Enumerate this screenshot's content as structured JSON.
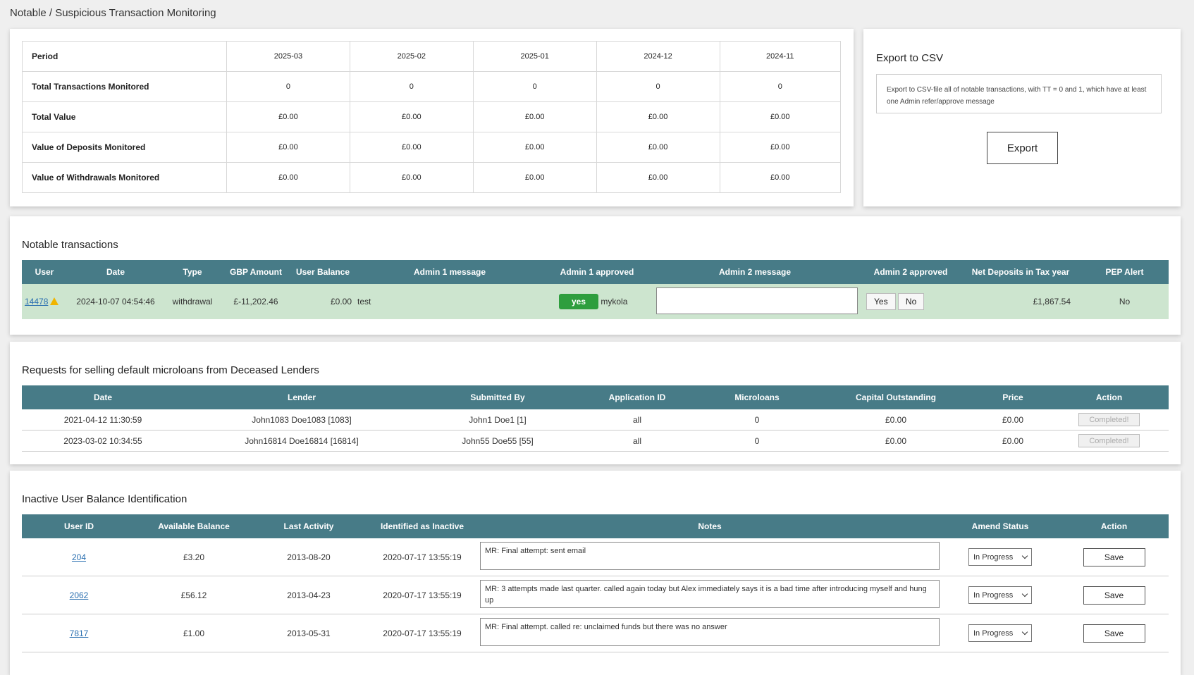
{
  "page_title": "Notable / Suspicious Transaction Monitoring",
  "summary": {
    "period_label": "Period",
    "periods": [
      "2025-03",
      "2025-02",
      "2025-01",
      "2024-12",
      "2024-11"
    ],
    "rows": [
      {
        "label": "Total Transactions Monitored",
        "values": [
          "0",
          "0",
          "0",
          "0",
          "0"
        ]
      },
      {
        "label": "Total Value",
        "values": [
          "£0.00",
          "£0.00",
          "£0.00",
          "£0.00",
          "£0.00"
        ]
      },
      {
        "label": "Value of Deposits Monitored",
        "values": [
          "£0.00",
          "£0.00",
          "£0.00",
          "£0.00",
          "£0.00"
        ]
      },
      {
        "label": "Value of Withdrawals Monitored",
        "values": [
          "£0.00",
          "£0.00",
          "£0.00",
          "£0.00",
          "£0.00"
        ]
      }
    ]
  },
  "export": {
    "title": "Export to CSV",
    "description": "Export to CSV-file all of notable transactions, with TT = 0 and 1, which have at least one Admin refer/approve message",
    "button_label": "Export"
  },
  "notable": {
    "title": "Notable transactions",
    "headers": [
      "User",
      "Date",
      "Type",
      "GBP Amount",
      "User Balance",
      "Admin 1 message",
      "Admin 1 approved",
      "Admin 2 message",
      "Admin 2 approved",
      "Net Deposits in Tax year",
      "PEP Alert"
    ],
    "row": {
      "user": "14478",
      "date": "2024-10-07 04:54:46",
      "type": "withdrawal",
      "gbp_amount": "£-11,202.46",
      "user_balance": "£0.00",
      "admin1_message": "test",
      "admin1_approved": "yes",
      "admin1_name": "mykola",
      "admin2_message": "",
      "yes_label": "Yes",
      "no_label": "No",
      "net_deposits": "£1,867.54",
      "pep_alert": "No"
    }
  },
  "deceased": {
    "title": "Requests for selling default microloans from Deceased Lenders",
    "headers": [
      "Date",
      "Lender",
      "Submitted By",
      "Application ID",
      "Microloans",
      "Capital Outstanding",
      "Price",
      "Action"
    ],
    "rows": [
      {
        "date": "2021-04-12 11:30:59",
        "lender": "John1083 Doe1083 [1083]",
        "submitted_by": "John1 Doe1 [1]",
        "application_id": "all",
        "microloans": "0",
        "capital": "£0.00",
        "price": "£0.00",
        "action": "Completed!"
      },
      {
        "date": "2023-03-02 10:34:55",
        "lender": "John16814 Doe16814 [16814]",
        "submitted_by": "John55 Doe55 [55]",
        "application_id": "all",
        "microloans": "0",
        "capital": "£0.00",
        "price": "£0.00",
        "action": "Completed!"
      }
    ]
  },
  "inactive": {
    "title": "Inactive User Balance Identification",
    "headers": [
      "User ID",
      "Available Balance",
      "Last Activity",
      "Identified as Inactive",
      "Notes",
      "Amend Status",
      "Action"
    ],
    "rows": [
      {
        "user_id": "204",
        "balance": "£3.20",
        "last_activity": "2013-08-20",
        "identified": "2020-07-17 13:55:19",
        "notes": "MR: Final attempt: sent email",
        "status": "In Progress",
        "action": "Save"
      },
      {
        "user_id": "2062",
        "balance": "£56.12",
        "last_activity": "2013-04-23",
        "identified": "2020-07-17 13:55:19",
        "notes": "MR: 3 attempts made last quarter. called again today but Alex immediately says it is a bad time after introducing myself and hung up",
        "status": "In Progress",
        "action": "Save"
      },
      {
        "user_id": "7817",
        "balance": "£1.00",
        "last_activity": "2013-05-31",
        "identified": "2020-07-17 13:55:19",
        "notes": "MR: Final attempt. called re: unclaimed funds but there was no answer",
        "status": "In Progress",
        "action": "Save"
      }
    ]
  }
}
